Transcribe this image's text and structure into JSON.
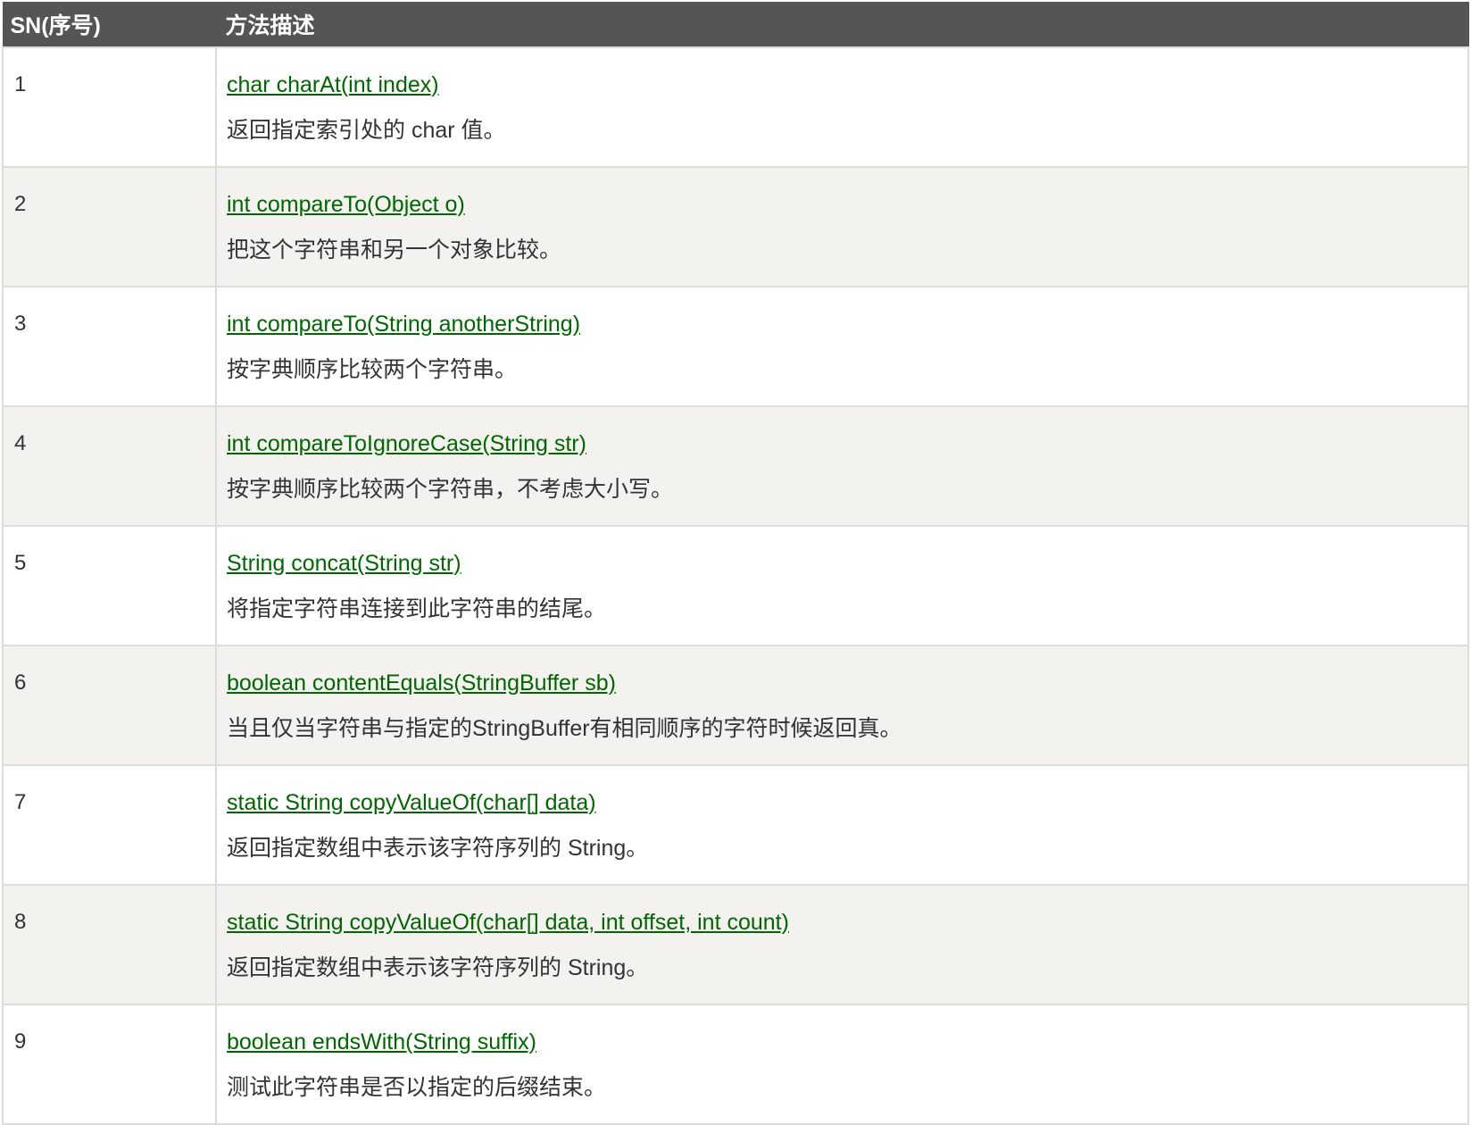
{
  "header": {
    "sn_label": "SN(序号)",
    "method_label": "方法描述"
  },
  "link_color": "#006600",
  "header_bg": "#555555",
  "even_row_bg": "#f3f2ef",
  "rows": [
    {
      "sn": "1",
      "method": "char charAt(int index)",
      "desc": "返回指定索引处的 char 值。"
    },
    {
      "sn": "2",
      "method": "int compareTo(Object o)",
      "desc": "把这个字符串和另一个对象比较。"
    },
    {
      "sn": "3",
      "method": "int compareTo(String anotherString)",
      "desc": "按字典顺序比较两个字符串。"
    },
    {
      "sn": "4",
      "method": "int compareToIgnoreCase(String str)",
      "desc": "按字典顺序比较两个字符串，不考虑大小写。"
    },
    {
      "sn": "5",
      "method": "String concat(String str)",
      "desc": "将指定字符串连接到此字符串的结尾。"
    },
    {
      "sn": "6",
      "method": "boolean contentEquals(StringBuffer sb)",
      "desc": "当且仅当字符串与指定的StringBuffer有相同顺序的字符时候返回真。"
    },
    {
      "sn": "7",
      "method": "static String copyValueOf(char[] data)",
      "desc": "返回指定数组中表示该字符序列的 String。"
    },
    {
      "sn": "8",
      "method": "static String copyValueOf(char[] data, int offset, int count)",
      "desc": "返回指定数组中表示该字符序列的 String。"
    },
    {
      "sn": "9",
      "method": "boolean endsWith(String suffix)",
      "desc": "测试此字符串是否以指定的后缀结束。"
    }
  ]
}
